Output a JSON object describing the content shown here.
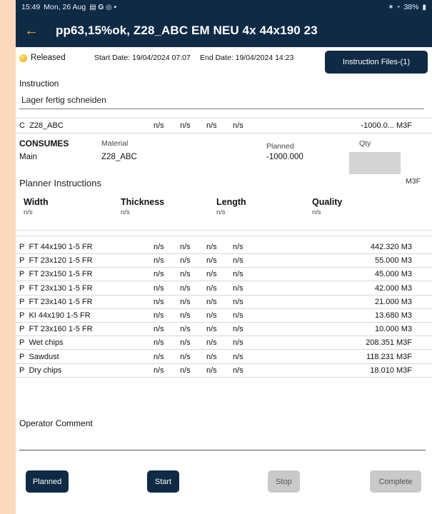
{
  "status_bar": {
    "time": "15:49",
    "date": "Mon, 26 Aug",
    "left_icons": "▤ G ◎ •",
    "right_icons": "✶ ◔",
    "battery": "38%"
  },
  "app_bar": {
    "back_icon": "←",
    "title": "pp63,15%ok, Z28_ABC EM NEU 4x 44x190 23"
  },
  "info": {
    "status": "Released",
    "start_date": "Start Date: 19/04/2024 07:07",
    "end_date": "End Date: 19/04/2024 14:23",
    "instruction_files_button": "Instruction Files-(1)"
  },
  "instruction": {
    "label": "Instruction",
    "value": "Lager fertig schneiden"
  },
  "consume_row": {
    "type": "C",
    "name": "Z28_ABC",
    "v1": "n/s",
    "v2": "n/s",
    "v3": "n/s",
    "v4": "n/s",
    "qty": "-1000.0... M3F"
  },
  "consumes": {
    "title": "CONSUMES",
    "sub": "Main",
    "material_label": "Material",
    "material_value": "Z28_ABC",
    "planned_label": "Planned",
    "planned_value": "-1000.000",
    "qty_label": "Qty",
    "qty_unit": "M3F"
  },
  "planner": {
    "title": "Planner Instructions",
    "columns": [
      {
        "label": "Width",
        "value": "n/s"
      },
      {
        "label": "Thickness",
        "value": "n/s"
      },
      {
        "label": "Length",
        "value": "n/s"
      },
      {
        "label": "Quality",
        "value": "n/s"
      }
    ]
  },
  "products": [
    {
      "type": "P",
      "name": "FT 44x190 1-5 FR",
      "v1": "n/s",
      "v2": "n/s",
      "v3": "n/s",
      "v4": "n/s",
      "qty": "442.320 M3"
    },
    {
      "type": "P",
      "name": "FT 23x120 1-5 FR",
      "v1": "n/s",
      "v2": "n/s",
      "v3": "n/s",
      "v4": "n/s",
      "qty": "55.000 M3"
    },
    {
      "type": "P",
      "name": "FT 23x150 1-5 FR",
      "v1": "n/s",
      "v2": "n/s",
      "v3": "n/s",
      "v4": "n/s",
      "qty": "45.000 M3"
    },
    {
      "type": "P",
      "name": "FT 23x130 1-5 FR",
      "v1": "n/s",
      "v2": "n/s",
      "v3": "n/s",
      "v4": "n/s",
      "qty": "42.000 M3"
    },
    {
      "type": "P",
      "name": "FT 23x140 1-5 FR",
      "v1": "n/s",
      "v2": "n/s",
      "v3": "n/s",
      "v4": "n/s",
      "qty": "21.000 M3"
    },
    {
      "type": "P",
      "name": "KI 44x190  1-5 FR",
      "v1": "n/s",
      "v2": "n/s",
      "v3": "n/s",
      "v4": "n/s",
      "qty": "13.680 M3"
    },
    {
      "type": "P",
      "name": "FT 23x160 1-5 FR",
      "v1": "n/s",
      "v2": "n/s",
      "v3": "n/s",
      "v4": "n/s",
      "qty": "10.000 M3"
    },
    {
      "type": "P",
      "name": "Wet chips",
      "v1": "n/s",
      "v2": "n/s",
      "v3": "n/s",
      "v4": "n/s",
      "qty": "208.351 M3F"
    },
    {
      "type": "P",
      "name": "Sawdust",
      "v1": "n/s",
      "v2": "n/s",
      "v3": "n/s",
      "v4": "n/s",
      "qty": "118.231 M3F"
    },
    {
      "type": "P",
      "name": "Dry chips",
      "v1": "n/s",
      "v2": "n/s",
      "v3": "n/s",
      "v4": "n/s",
      "qty": "18.010 M3F"
    }
  ],
  "operator": {
    "label": "Operator Comment"
  },
  "buttons": {
    "planned": "Planned",
    "start": "Start",
    "stop": "Stop",
    "complete": "Complete"
  },
  "colors": {
    "primary": "#0f2a45",
    "accent": "#f5a623",
    "disabled": "#c9c9c9",
    "frame": "#fbd9bd"
  }
}
